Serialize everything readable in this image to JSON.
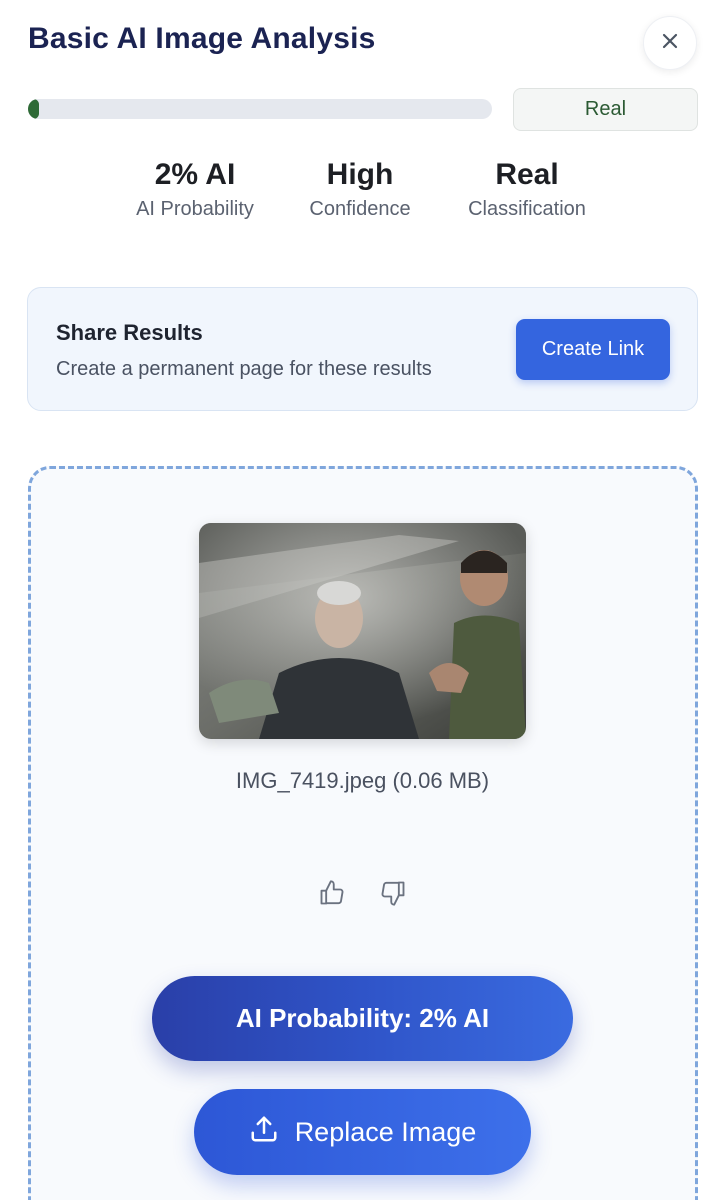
{
  "header": {
    "title": "Basic AI Image Analysis"
  },
  "progress": {
    "ai_fraction": 0.02
  },
  "badge": {
    "label": "Real"
  },
  "stats": [
    {
      "value": "2% AI",
      "label": "AI Probability"
    },
    {
      "value": "High",
      "label": "Confidence"
    },
    {
      "value": "Real",
      "label": "Classification"
    }
  ],
  "share": {
    "title": "Share Results",
    "description": "Create a permanent page for these results",
    "button_label": "Create Link"
  },
  "file": {
    "name": "IMG_7419.jpeg (0.06 MB)"
  },
  "actions": {
    "ai_probability_label": "AI Probability: 2% AI",
    "replace_label": "Replace Image"
  },
  "icons": {
    "close": "close-icon",
    "thumbs_up": "thumbs-up-icon",
    "thumbs_down": "thumbs-down-icon",
    "upload": "upload-icon"
  },
  "colors": {
    "accent": "#3465df",
    "real_green": "#2e6a36",
    "title_navy": "#1b2352"
  }
}
